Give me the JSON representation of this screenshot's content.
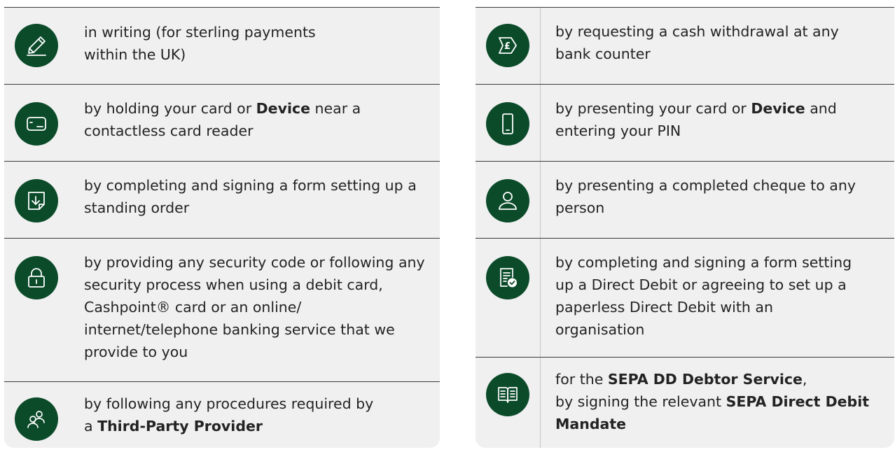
{
  "left": {
    "rows": [
      {
        "icon": "pen-icon",
        "text": "in writing (for sterling payments within the UK)"
      },
      {
        "icon": "contactless-card-icon",
        "pre": "by holding your card or ",
        "bold": "Device",
        "post": " near a contactless card reader"
      },
      {
        "icon": "form-download-icon",
        "text": "by completing and signing a form setting up a standing order"
      },
      {
        "icon": "padlock-icon",
        "text": "by providing any security code or following any security process when using a debit card, Cashpoint® card or an online/ internet/telephone banking service that we provide to you"
      },
      {
        "icon": "third-party-users-icon",
        "pre": "by following any procedures required by a ",
        "bold": "Third-Party Provider",
        "post": ""
      }
    ]
  },
  "right": {
    "rows": [
      {
        "icon": "cash-pound-icon",
        "text": "by requesting a cash withdrawal at any bank counter"
      },
      {
        "icon": "mobile-phone-icon",
        "pre": "by presenting your card or ",
        "bold": "Device",
        "post": " and entering your PIN"
      },
      {
        "icon": "person-icon",
        "text": "by presenting a completed cheque to any person"
      },
      {
        "icon": "document-check-icon",
        "text": "by completing and signing a form setting up a Direct Debit or agreeing to set up a paperless Direct Debit with an organisation"
      },
      {
        "icon": "open-book-icon",
        "pre": "for the ",
        "bold": "SEPA DD Debtor Service",
        "post": ",",
        "pre2": "by signing the relevant ",
        "bold2": "SEPA Direct Debit Mandate"
      }
    ]
  }
}
